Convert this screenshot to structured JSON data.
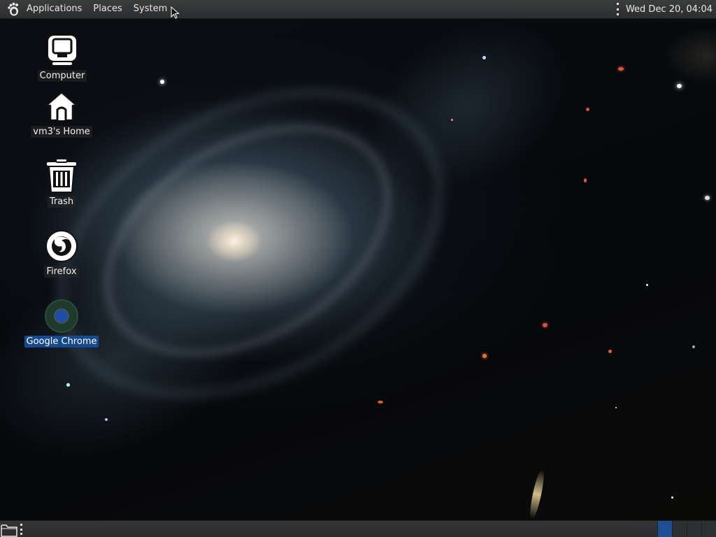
{
  "top_panel": {
    "logo_icon": "gnome-foot-icon",
    "menus": [
      {
        "label": "Applications"
      },
      {
        "label": "Places"
      },
      {
        "label": "System"
      }
    ],
    "clock": "Wed Dec 20, 04:04"
  },
  "desktop": {
    "icons": [
      {
        "label": "Computer",
        "icon": "computer-icon"
      },
      {
        "label": "vm3's Home",
        "icon": "home-icon"
      },
      {
        "label": "Trash",
        "icon": "trash-icon"
      },
      {
        "label": "Firefox",
        "icon": "firefox-icon"
      },
      {
        "label": "Google Chrome",
        "icon": "chrome-icon",
        "selected": true
      }
    ]
  },
  "bottom_panel": {
    "show_desktop_icon": "show-desktop-icon",
    "workspaces": [
      {
        "active": true
      },
      {
        "active": false
      },
      {
        "active": false
      },
      {
        "active": false
      }
    ]
  },
  "colors": {
    "panel": "#2f3031",
    "selection": "#174a8c",
    "workspace_active": "#1e4f96"
  }
}
